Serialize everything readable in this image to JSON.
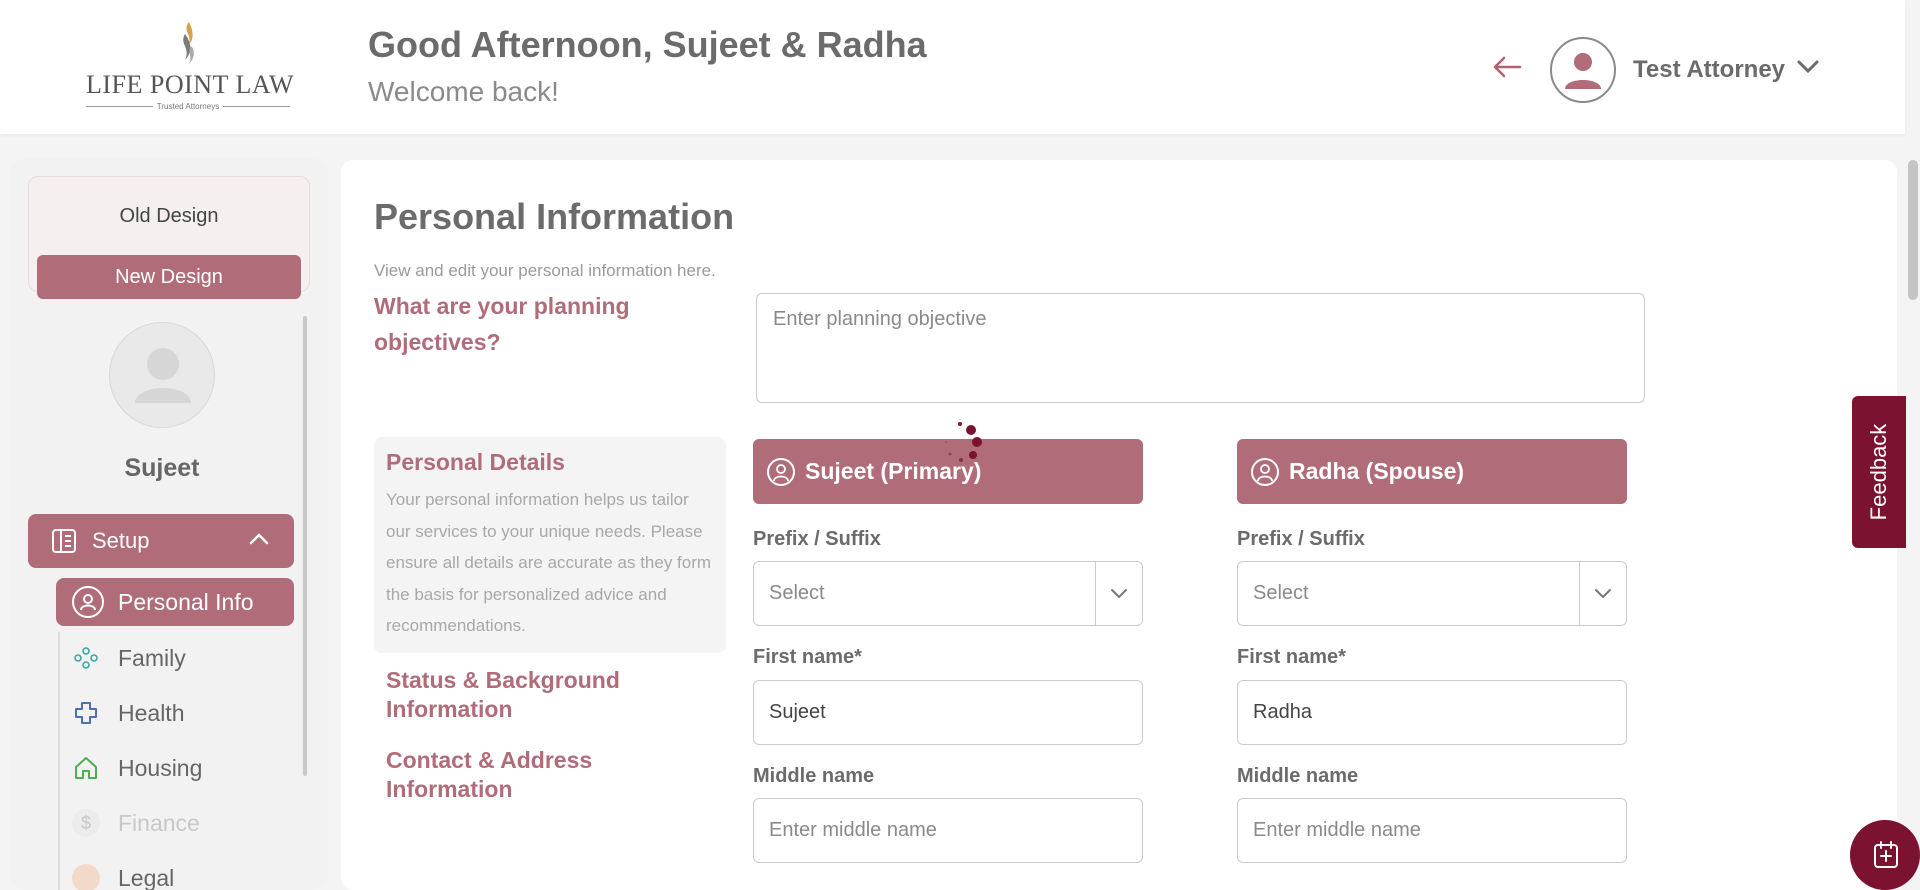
{
  "header": {
    "logo_text": "LIFE POINT LAW",
    "logo_tagline": "Trusted Attorneys",
    "greeting": "Good Afternoon, Sujeet & Radha",
    "welcome": "Welcome back!",
    "user_name": "Test Attorney"
  },
  "sidebar": {
    "old_design": "Old Design",
    "new_design": "New Design",
    "client_name": "Sujeet",
    "setup_label": "Setup",
    "items": [
      {
        "label": "Personal Info",
        "icon": "user-circle-icon"
      },
      {
        "label": "Family",
        "icon": "family-icon"
      },
      {
        "label": "Health",
        "icon": "health-cross-icon"
      },
      {
        "label": "Housing",
        "icon": "house-icon"
      },
      {
        "label": "Finance",
        "icon": "dollar-icon"
      },
      {
        "label": "Legal",
        "icon": "legal-icon"
      }
    ]
  },
  "main": {
    "title": "Personal Information",
    "subtitle": "View and edit your personal information here.",
    "objective_question": "What are your planning objectives?",
    "objective_placeholder": "Enter planning objective",
    "details_title": "Personal Details",
    "details_text": "Your personal information helps us tailor our services to your unique needs. Please ensure all details are accurate as they form the basis for personalized advice and recommendations.",
    "section_status": "Status & Background Information",
    "section_contact": "Contact & Address Information",
    "primary": {
      "heading": "Sujeet (Primary)",
      "prefix_label": "Prefix / Suffix",
      "prefix_value": "Select",
      "first_label": "First name*",
      "first_value": "Sujeet",
      "middle_label": "Middle name",
      "middle_placeholder": "Enter middle name"
    },
    "spouse": {
      "heading": "Radha (Spouse)",
      "prefix_label": "Prefix / Suffix",
      "prefix_value": "Select",
      "first_label": "First name*",
      "first_value": "Radha",
      "middle_label": "Middle name",
      "middle_placeholder": "Enter middle name"
    }
  },
  "feedback_label": "Feedback",
  "colors": {
    "accent": "#b06c79",
    "dark_accent": "#7a1230"
  }
}
